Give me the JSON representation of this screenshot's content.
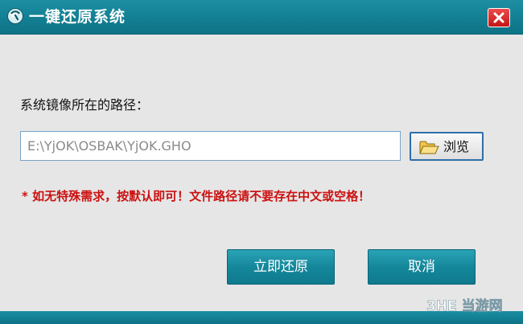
{
  "window": {
    "title": "一键还原系统",
    "icons": {
      "app": "app-logo-icon",
      "close": "close-icon"
    },
    "colors": {
      "titlebar": "#137f93",
      "close": "#d42020",
      "warning": "#cc1010",
      "button": "#15879b"
    }
  },
  "form": {
    "label": "系统镜像所在的路径：",
    "path_value": "E:\\YjOK\\OSBAK\\YjOK.GHO",
    "browse_label": "浏览",
    "browse_icon": "folder-open-icon",
    "warning": "* 如无特殊需求，按默认即可！文件路径请不要存在中文或空格！"
  },
  "actions": {
    "restore_label": "立即还原",
    "cancel_label": "取消"
  },
  "watermark": {
    "text": "3HE 当游网"
  }
}
